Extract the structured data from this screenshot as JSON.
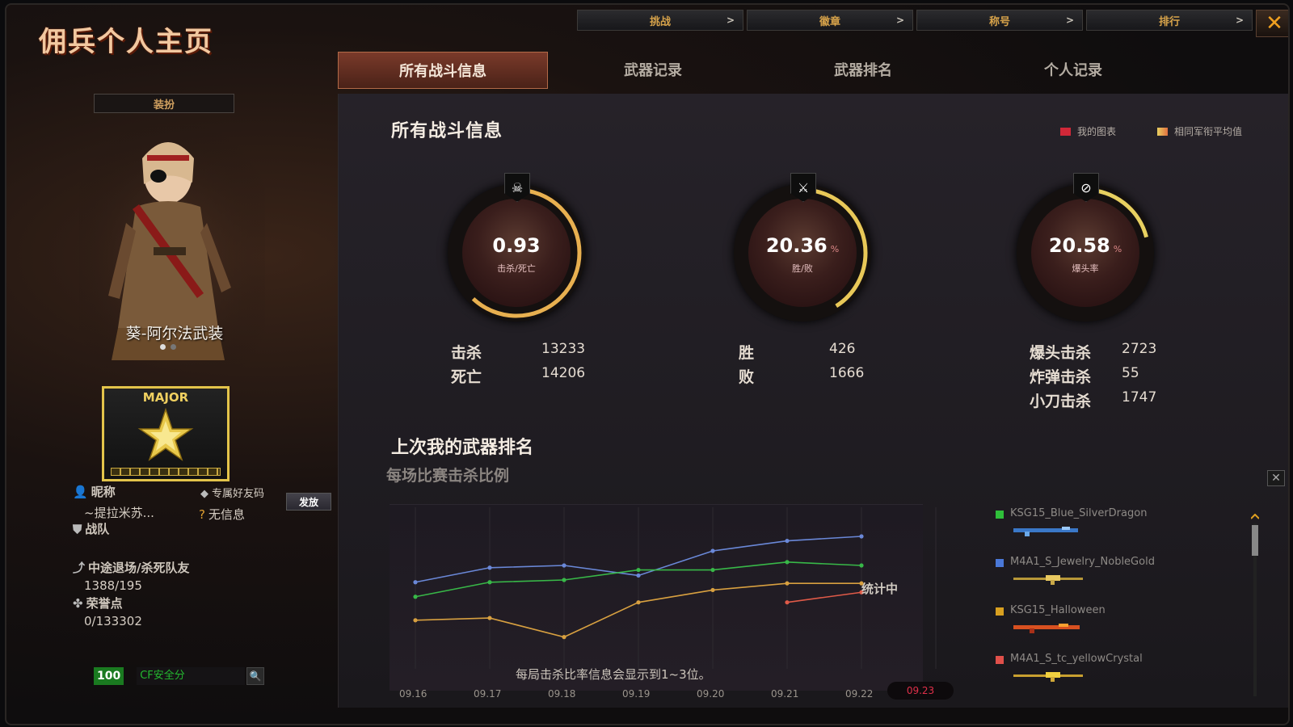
{
  "window": {
    "title": "佣兵个人主页"
  },
  "topnav": [
    {
      "label": "挑战"
    },
    {
      "label": "徽章"
    },
    {
      "label": "称号"
    },
    {
      "label": "排行"
    }
  ],
  "close_glyph": "✕",
  "tabs": [
    {
      "label": "所有战斗信息",
      "active": true
    },
    {
      "label": "武器记录"
    },
    {
      "label": "武器排名"
    },
    {
      "label": "个人记录"
    }
  ],
  "left": {
    "outfit_caption": "装扮",
    "costume_name": "葵-阿尔法武装",
    "rank_title": "MAJOR",
    "nickname_label": "昵称",
    "nickname_value": "~提拉米苏...",
    "friend_code_label": "专属好友码",
    "friend_code_button": "发放",
    "friend_code_value": "无信息",
    "clan_label": "战队",
    "leave_label": "中途退场/杀死队友",
    "leave_value": "1388/195",
    "honor_label": "荣誉点",
    "honor_value": "0/133302",
    "safety_score": "100",
    "safety_label": "CF安全分"
  },
  "battle": {
    "title": "所有战斗信息",
    "legend_mine": "我的图表",
    "legend_avg": "相同军衔平均值",
    "gauges": [
      {
        "value": "0.93",
        "unit": "",
        "label": "击杀/死亡",
        "icon": "skull-icon",
        "glyph": "☠",
        "fraction": 0.62
      },
      {
        "value": "20.36",
        "unit": "%",
        "label": "胜/败",
        "icon": "crossed-guns-icon",
        "glyph": "⚔",
        "fraction": 0.41
      },
      {
        "value": "20.58",
        "unit": "%",
        "label": "爆头率",
        "icon": "headshot-icon",
        "glyph": "⊘",
        "fraction": 0.21
      }
    ],
    "stats": {
      "kills_label": "击杀",
      "kills_value": "13233",
      "deaths_label": "死亡",
      "deaths_value": "14206",
      "wins_label": "胜",
      "wins_value": "426",
      "losses_label": "败",
      "losses_value": "1666",
      "headshot_label": "爆头击杀",
      "headshot_value": "2723",
      "bomb_label": "炸弹击杀",
      "bomb_value": "55",
      "knife_label": "小刀击杀",
      "knife_value": "1747"
    }
  },
  "weapons": {
    "title": "上次我的武器排名",
    "subtitle": "每场比赛击杀比例",
    "status": "统计中",
    "note": "每局击杀比率信息会显示到1~3位。",
    "close_glyph": "✕",
    "list": [
      {
        "name": "KSG15_Blue_SilverDragon",
        "color": "#2fbf3a"
      },
      {
        "name": "M4A1_S_Jewelry_NobleGold",
        "color": "#4a78d8"
      },
      {
        "name": "KSG15_Halloween",
        "color": "#d8a020"
      },
      {
        "name": "M4A1_S_tc_yellowCrystal",
        "color": "#e0504a"
      }
    ]
  },
  "chart_data": {
    "type": "line",
    "x": [
      "09.16",
      "09.17",
      "09.18",
      "09.19",
      "09.20",
      "09.21",
      "09.22",
      "09.23"
    ],
    "selected_x": "09.23",
    "grid": true,
    "series": [
      {
        "color": "#6a88d8",
        "values": [
          0.63,
          0.76,
          0.78,
          0.69,
          0.91,
          1.0,
          1.04,
          null
        ]
      },
      {
        "color": "#38b848",
        "values": [
          0.5,
          0.63,
          0.65,
          0.74,
          0.74,
          0.81,
          0.78,
          null
        ]
      },
      {
        "color": "#d8a040",
        "values": [
          0.29,
          0.31,
          0.14,
          0.45,
          0.56,
          0.62,
          0.62,
          null
        ]
      },
      {
        "color": "#e05a48",
        "values": [
          null,
          null,
          null,
          null,
          null,
          0.45,
          0.54,
          null
        ]
      }
    ],
    "ylim": [
      0,
      1.3
    ]
  }
}
